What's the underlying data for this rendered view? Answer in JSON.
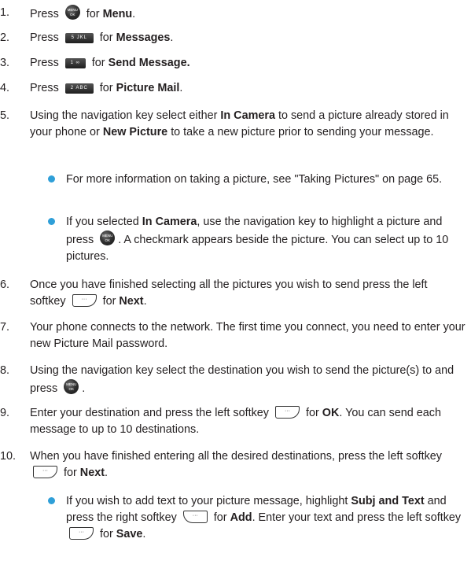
{
  "steps": [
    {
      "num": "1.",
      "t0": "Press",
      "t1": "for",
      "b1": "Menu",
      "t2": "."
    },
    {
      "num": "2.",
      "t0": "Press",
      "t1": "for",
      "b1": "Messages",
      "t2": "."
    },
    {
      "num": "3.",
      "t0": "Press",
      "t1": "for",
      "b1": "Send Message."
    },
    {
      "num": "4.",
      "t0": "Press",
      "t1": "for",
      "b1": "Picture Mail",
      "t2": "."
    },
    {
      "num": "5.",
      "t0": "Using the navigation key select either",
      "b1": "In Camera",
      "t1": "to send a picture already stored in your phone or",
      "b2": "New Picture",
      "t2": "to take a new picture prior to sending your message."
    },
    {
      "num": "6.",
      "t0": "Once you have finished selecting all the pictures you wish to send press the left softkey",
      "t1": "for",
      "b1": "Next",
      "t2": "."
    },
    {
      "num": "7.",
      "t0": "Your phone connects to the network. The first time you connect, you need to enter your new Picture Mail password."
    },
    {
      "num": "8.",
      "t0": "Using the navigation key select the destination you wish to send the picture(s) to and press",
      "t1": "."
    },
    {
      "num": "9.",
      "t0": "Enter your destination and press the left softkey",
      "t1": "for",
      "b1": "OK",
      "t2": ". You can send each message to up to 10 destinations."
    },
    {
      "num": "10.",
      "t0": "When you have finished entering all the desired destinations, press the left softkey",
      "t1": "for",
      "b1": "Next",
      "t2": "."
    }
  ],
  "bullets": [
    {
      "t0": "For more information on taking a picture, see \"Taking Pictures\" on page 65."
    },
    {
      "t0": "If you selected",
      "b1": "In Camera",
      "t1": ", use the navigation key to highlight a picture and press",
      "t2": ". A checkmark appears beside the picture. You can select up to 10 pictures."
    },
    {
      "t0": "If you wish to add text to your picture message, highlight",
      "b1": "Subj and Text",
      "t1": "and press the right softkey",
      "t2": "for",
      "b2": "Add",
      "t3": ". Enter your text and press the left softkey",
      "t4": "for",
      "b3": "Save",
      "t5": "."
    }
  ],
  "icons": {
    "menu_ok_key": "MENU OK",
    "key_5": "5 JKL",
    "key_1": "1 ∞",
    "key_2": "2 ABC",
    "softkey": "···",
    "bullet_color": "#2f9fd8"
  }
}
